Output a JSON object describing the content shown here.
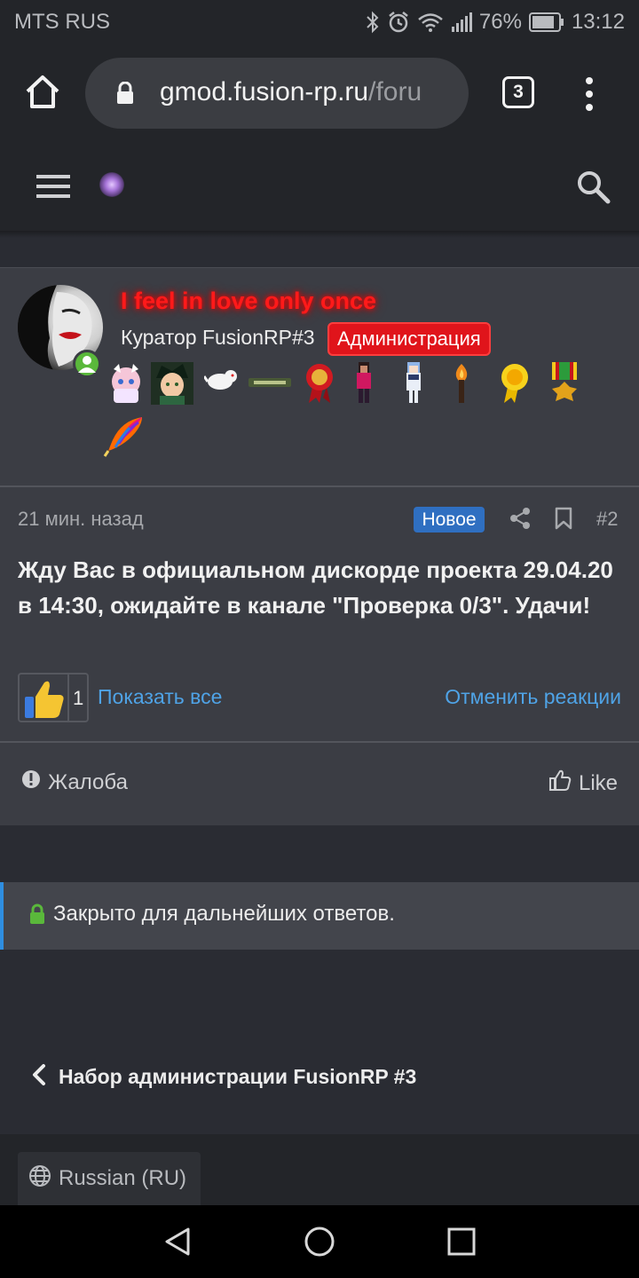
{
  "status_bar": {
    "carrier": "MTS RUS",
    "battery": "76%",
    "time": "13:12",
    "icons": [
      "bluetooth-icon",
      "alarm-icon",
      "wifi-icon",
      "signal-icon",
      "battery-icon"
    ]
  },
  "browser": {
    "url_domain": "gmod.fusion-rp.ru",
    "url_path": "/foru",
    "tab_count": "3"
  },
  "post": {
    "username": "I feel in love only once",
    "user_title": "Куратор FusionRP#3",
    "user_badge": "Администрация",
    "time": "21 мин. назад",
    "new_label": "Новое",
    "number": "#2",
    "body": "Жду Вас в официальном дискорде проекта 29.04.20 в 14:30, ожидайте в канале \"Проверка 0/3\". Удачи!",
    "reaction_count": "1",
    "show_all": "Показать все",
    "cancel_reactions": "Отменить реакции",
    "report": "Жалоба",
    "like": "Like"
  },
  "closed_notice": "Закрыто для дальнейших ответов.",
  "back_link": "Набор администрации FusionRP #3",
  "footer": {
    "language": "Russian (RU)"
  },
  "colors": {
    "username": "#ff1a1a",
    "badge_bg": "#e0141b",
    "link": "#4fa3e6",
    "new_badge": "#2f6fc1",
    "online": "#5ab83b",
    "closed_accent": "#2f8ee0"
  }
}
